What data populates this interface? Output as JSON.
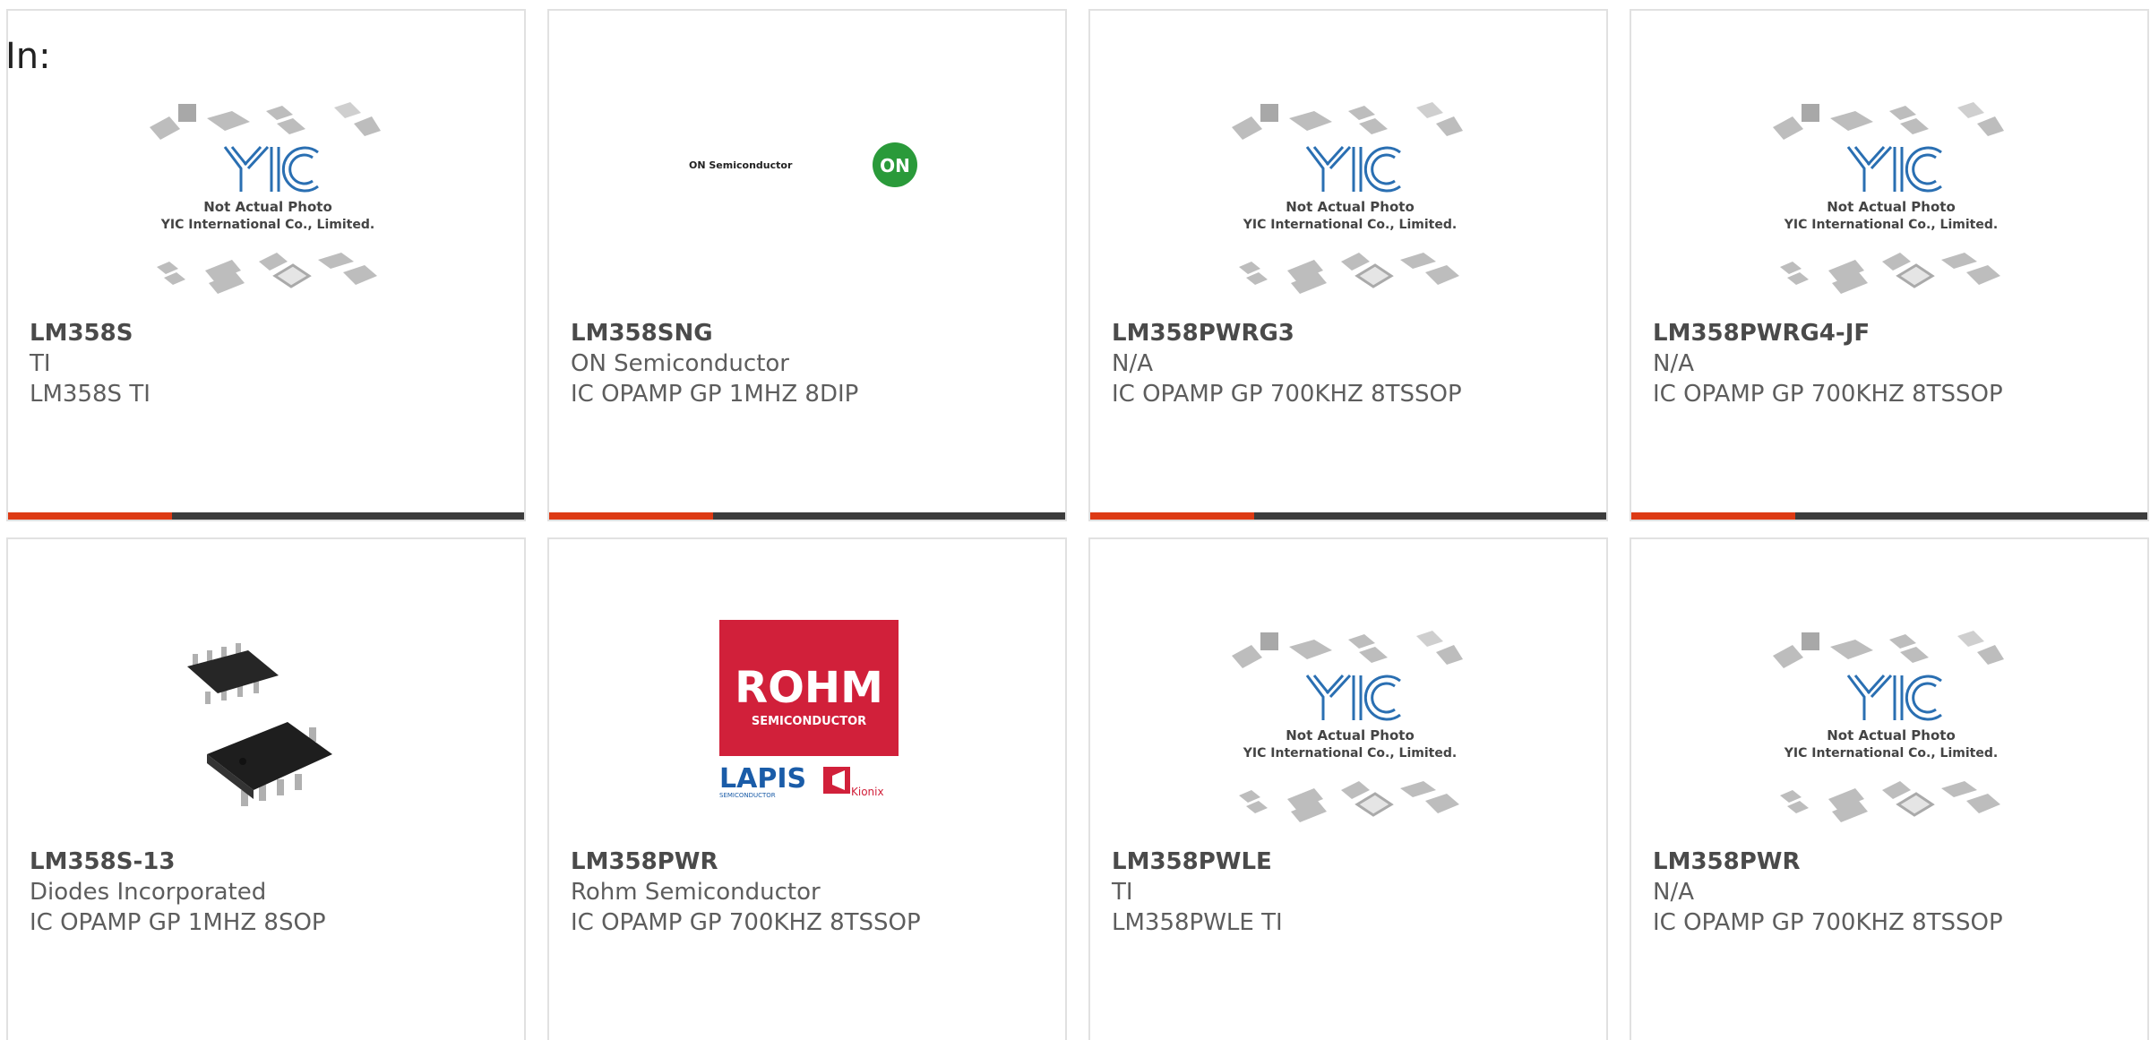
{
  "filter_label": "In:",
  "placeholder": {
    "line1": "Not Actual Photo",
    "line2": "YIC International Co., Limited."
  },
  "onsemi": {
    "text": "ON Semiconductor",
    "badge": "ON"
  },
  "rohm": {
    "brand": "ROHM",
    "sub": "SEMICONDUCTOR",
    "lapis": "LAPIS",
    "lapis_sub": "SEMICONDUCTOR",
    "kionix": "Kionix"
  },
  "colors": {
    "accent": "#dd3a14",
    "bar": "#3c3c3c",
    "rohm_red": "#d1203a",
    "on_green": "#2a9a3a",
    "yic_blue": "#2a6fb2"
  },
  "products": [
    {
      "part": "LM358S",
      "mfr": "TI",
      "desc": "LM358S TI",
      "image": "yic-placeholder"
    },
    {
      "part": "LM358SNG",
      "mfr": "ON Semiconductor",
      "desc": "IC OPAMP GP 1MHZ 8DIP",
      "image": "onsemi-logo"
    },
    {
      "part": "LM358PWRG3",
      "mfr": "N/A",
      "desc": "IC OPAMP GP 700KHZ 8TSSOP",
      "image": "yic-placeholder"
    },
    {
      "part": "LM358PWRG4-JF",
      "mfr": "N/A",
      "desc": "IC OPAMP GP 700KHZ 8TSSOP",
      "image": "yic-placeholder"
    },
    {
      "part": "LM358S-13",
      "mfr": "Diodes Incorporated",
      "desc": "IC OPAMP GP 1MHZ 8SOP",
      "image": "soic-chip-photo"
    },
    {
      "part": "LM358PWR",
      "mfr": "Rohm Semiconductor",
      "desc": "IC OPAMP GP 700KHZ 8TSSOP",
      "image": "rohm-logo"
    },
    {
      "part": "LM358PWLE",
      "mfr": "TI",
      "desc": "LM358PWLE TI",
      "image": "yic-placeholder"
    },
    {
      "part": "LM358PWR",
      "mfr": "N/A",
      "desc": "IC OPAMP GP 700KHZ 8TSSOP",
      "image": "yic-placeholder"
    }
  ]
}
